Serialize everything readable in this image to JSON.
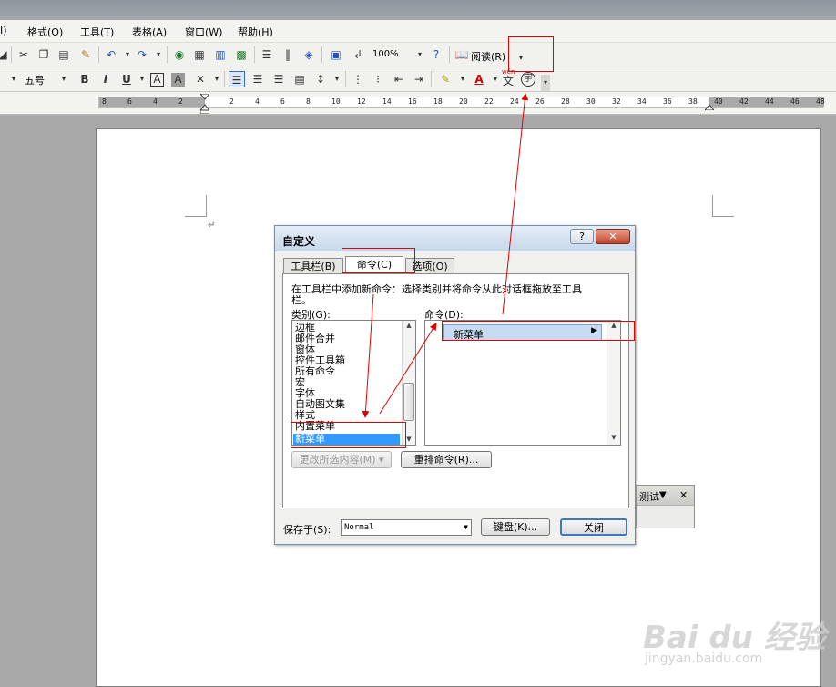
{
  "menubar": {
    "items": [
      "工具(T)",
      "表格(A)",
      "窗口(W)",
      "帮助(H)"
    ],
    "partial_items": [
      "I)",
      "格式(O)"
    ]
  },
  "toolbar1": {
    "zoom": "100%",
    "read_label": "阅读(R)"
  },
  "toolbar2": {
    "font_size": "五号",
    "bold": "B",
    "italic": "I",
    "underline": "U",
    "char_border": "A",
    "char_shading": "A",
    "font_color": "A",
    "phonetic": "wén",
    "phonetic_char": "文",
    "enclosed_char": "字"
  },
  "ruler": {
    "ticks": [
      "8",
      "6",
      "4",
      "2",
      "2",
      "4",
      "6",
      "8",
      "10",
      "12",
      "14",
      "16",
      "18",
      "20",
      "22",
      "24",
      "26",
      "28",
      "30",
      "32",
      "34",
      "36",
      "38",
      "40",
      "42",
      "44",
      "46",
      "48"
    ]
  },
  "dialog": {
    "title": "自定义",
    "help_button": "?",
    "close_button": "✕",
    "tabs": [
      "工具栏(B)",
      "命令(C)",
      "选项(O)"
    ],
    "description": "在工具栏中添加新命令：选择类别并将命令从此对话框拖放至工具栏。",
    "description_line1": "在工具栏中添加新命令：选择类别并将命令从此对话框拖放至工具",
    "description_line2": "栏。",
    "categories_label": "类别(G):",
    "commands_label": "命令(D):",
    "categories": [
      "边框",
      "邮件合并",
      "窗体",
      "控件工具箱",
      "所有命令",
      "宏",
      "字体",
      "自动图文集",
      "样式",
      "内置菜单",
      "新菜单"
    ],
    "selected_category": "新菜单",
    "commands": [
      "新菜单"
    ],
    "modify_selection_button": "更改所选内容(M) ▾",
    "rearrange_button": "重排命令(R)...",
    "save_in_label": "保存于(S):",
    "save_in_value": "Normal",
    "keyboard_button": "键盘(K)...",
    "close_label": "关闭"
  },
  "floating_toolbar": {
    "title": "测试",
    "dropdown_glyph": "▼",
    "close_glyph": "✕"
  },
  "watermark": {
    "brand": "Bai du 经验",
    "url": "jingyan.baidu.com"
  },
  "colors": {
    "annotation_red": "#e00000",
    "selection_blue": "#3399ff",
    "dialog_title": "#c7d7ea"
  }
}
